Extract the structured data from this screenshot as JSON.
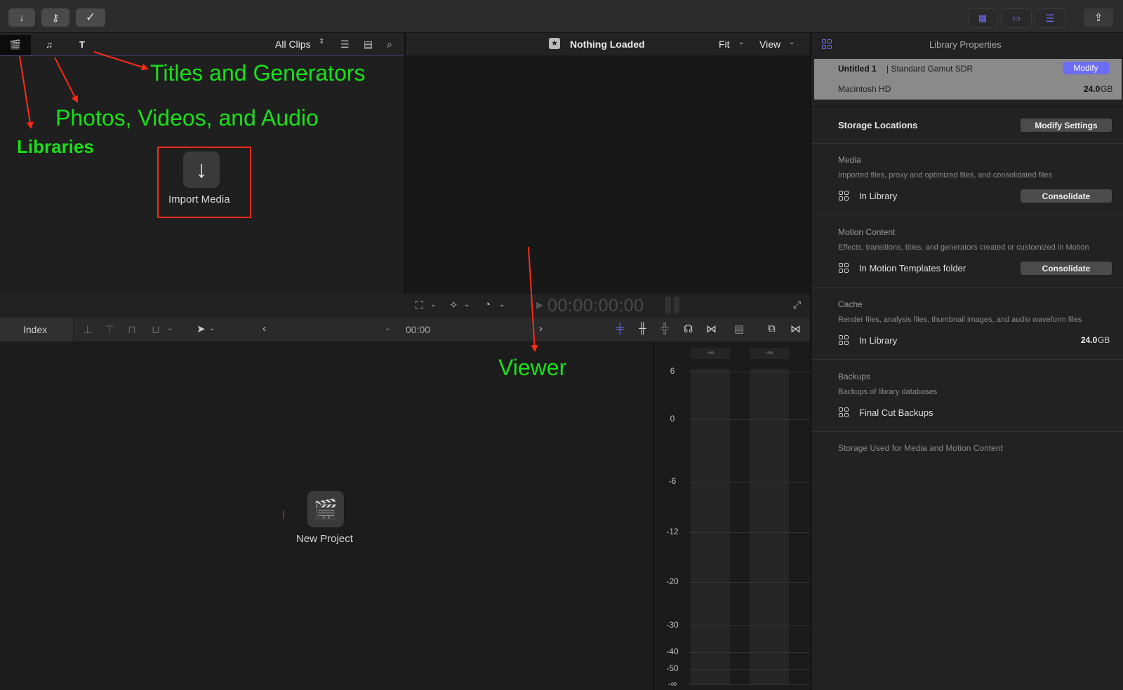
{
  "browser": {
    "filter_label": "All Clips",
    "filter_chevron": "⌃⌄",
    "import_media_label": "Import Media"
  },
  "viewer": {
    "title": "Nothing Loaded",
    "fit_label": "Fit",
    "view_label": "View",
    "timecode": "00:00:00:00"
  },
  "timeline_bar": {
    "index_label": "Index",
    "timecode": "00:00"
  },
  "timeline": {
    "new_project_label": "New Project"
  },
  "meters": {
    "peak_left": "-∞",
    "peak_right": "-∞",
    "scale": [
      "6",
      "0",
      "-6",
      "-12",
      "-20",
      "-30",
      "-40",
      "-50",
      "-∞"
    ]
  },
  "inspector": {
    "title": "Library Properties",
    "library_name": "Untitled 1",
    "library_format": "| Standard Gamut SDR",
    "modify_label": "Modify",
    "drive_name": "Macintosh HD",
    "drive_size": "24.0",
    "drive_unit": "GB",
    "storage_title": "Storage Locations",
    "modify_settings_label": "Modify Settings",
    "media_title": "Media",
    "media_desc": "Imported files, proxy and optimized files, and consolidated files",
    "media_location": "In Library",
    "media_consolidate": "Consolidate",
    "motion_title": "Motion Content",
    "motion_desc": "Effects, transitions, titles, and generators created or customized in Motion",
    "motion_location": "In Motion Templates folder",
    "motion_consolidate": "Consolidate",
    "cache_title": "Cache",
    "cache_desc": "Render files, analysis files, thumbnail images, and audio waveform files",
    "cache_location": "In Library",
    "cache_size": "24.0",
    "cache_unit": "GB",
    "backups_title": "Backups",
    "backups_desc": "Backups of library databases",
    "backups_location": "Final Cut Backups",
    "storage_used": "Storage Used for Media and Motion Content"
  },
  "annotations": {
    "titles_generators": "Titles and Generators",
    "photos_videos_audio": "Photos, Videos, and Audio",
    "libraries": "Libraries",
    "viewer": "Viewer"
  },
  "colors": {
    "accent": "#6d6cf5",
    "annotation_green": "#19e019",
    "annotation_red": "#ff2a1a"
  }
}
